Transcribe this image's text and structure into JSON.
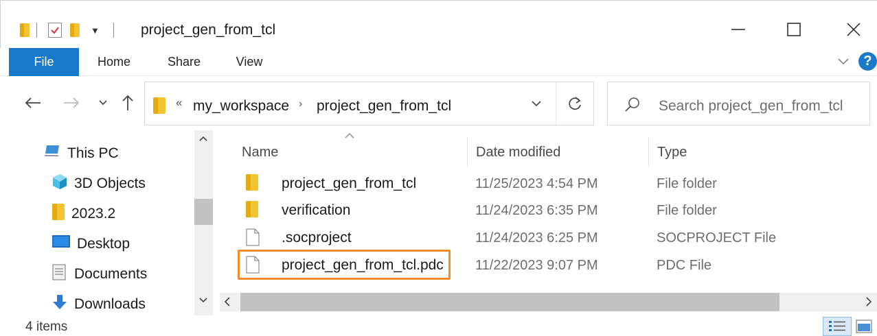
{
  "window": {
    "title": "project_gen_from_tcl",
    "buttons": {
      "minimize": "minimize-icon",
      "maximize": "maximize-icon",
      "close": "close-icon"
    }
  },
  "ribbon": {
    "tabs": [
      {
        "label": "File",
        "active": true
      },
      {
        "label": "Home"
      },
      {
        "label": "Share"
      },
      {
        "label": "View"
      }
    ],
    "help": "?"
  },
  "address": {
    "overflow": "«",
    "crumbs": [
      "my_workspace",
      "project_gen_from_tcl"
    ],
    "separator": "›"
  },
  "search": {
    "placeholder": "Search project_gen_from_tcl"
  },
  "nav_pane": {
    "items": [
      {
        "label": "This PC",
        "icon": "computer-icon"
      },
      {
        "label": "3D Objects",
        "icon": "cube-icon"
      },
      {
        "label": "2023.2",
        "icon": "folder-icon"
      },
      {
        "label": "Desktop",
        "icon": "desktop-icon"
      },
      {
        "label": "Documents",
        "icon": "documents-icon"
      },
      {
        "label": "Downloads",
        "icon": "download-icon"
      }
    ]
  },
  "file_list": {
    "columns": [
      "Name",
      "Date modified",
      "Type"
    ],
    "rows": [
      {
        "name": "project_gen_from_tcl",
        "date": "11/25/2023 4:54 PM",
        "type": "File folder",
        "icon": "folder-icon"
      },
      {
        "name": "verification",
        "date": "11/24/2023 6:35 PM",
        "type": "File folder",
        "icon": "folder-icon"
      },
      {
        "name": ".socproject",
        "date": "11/24/2023 6:25 PM",
        "type": "SOCPROJECT File",
        "icon": "file-icon"
      },
      {
        "name": "project_gen_from_tcl.pdc",
        "date": "11/22/2023 9:07 PM",
        "type": "PDC File",
        "icon": "file-icon",
        "highlighted": true
      }
    ]
  },
  "status_bar": {
    "item_count": "4 items"
  },
  "colors": {
    "accent": "#1979ca",
    "highlight": "#f08c2a",
    "folder": "#f4c430"
  }
}
